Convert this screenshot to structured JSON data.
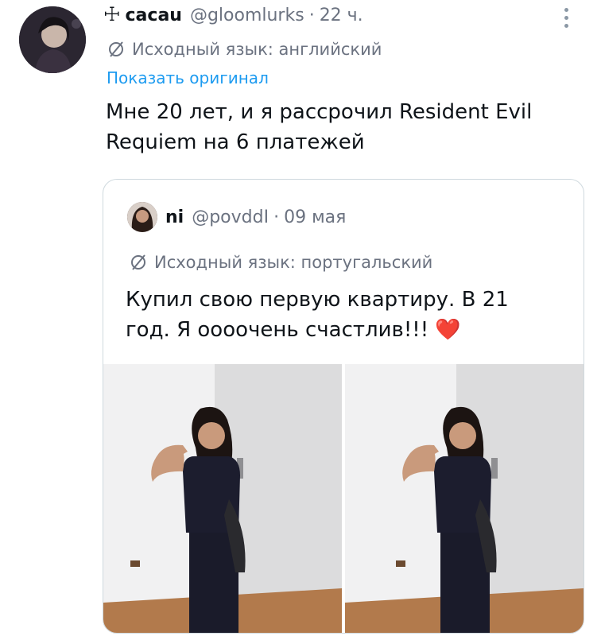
{
  "tweet": {
    "cross_glyph": "☩",
    "display_name": "cacau",
    "handle": "@gloomlurks",
    "separator": "·",
    "time": "22 ч.",
    "translated_from": "Исходный язык: английский",
    "show_original": "Показать оригинал",
    "text": "Мне 20 лет, и я рассрочил Resident Evil Requiem на 6 платежей"
  },
  "quote": {
    "display_name": "ni",
    "handle": "@povddI",
    "separator": "·",
    "time": "09 мая",
    "translated_from": "Исходный язык: португальский",
    "text": "Купил свою первую квартиру. В 21 год. Я оооочень счастлив!!!",
    "emoji": "❤️"
  },
  "colors": {
    "link": "#1d9bf0",
    "muted": "#6b7280",
    "border": "#cfd9de",
    "heart": "#e0245e"
  },
  "icons": [
    "more-options-icon",
    "translate-icon",
    "heart-emoji"
  ]
}
